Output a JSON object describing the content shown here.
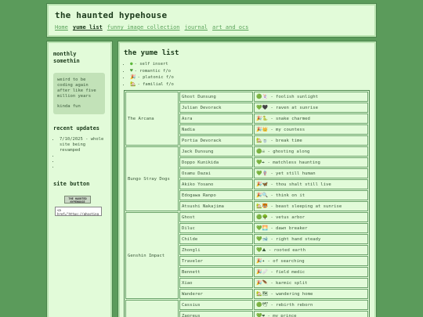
{
  "header": {
    "title": "the haunted hypehouse",
    "nav": [
      {
        "label": "Home",
        "active": false
      },
      {
        "label": "yume list",
        "active": true
      },
      {
        "label": "funny image collection",
        "active": false
      },
      {
        "label": "journal",
        "active": false
      },
      {
        "label": "art and ocs",
        "active": false
      }
    ]
  },
  "sidebar": {
    "monthly_title": "monthly somethin",
    "monthly_text": "weird to be coding again after like five million years",
    "monthly_text2": "kinda fun",
    "updates_title": "recent updates",
    "updates": [
      "7/10/2025 - whole site being revamped",
      "",
      "",
      ""
    ],
    "button_title": "site button",
    "button_label": "THE HAUNTED HYPEHOUSE",
    "button_code": "<a href=\"https://ghosting"
  },
  "main": {
    "title": "the yume list",
    "legend": [
      {
        "icon": "green-circle",
        "color": "#5cb83a",
        "text": "- self insert"
      },
      {
        "icon": "green-heart",
        "color": "#4a9b3a",
        "text": "- romantic f/o"
      },
      {
        "icon": "party-popper",
        "color": "#d9a020",
        "text": "- platonic f/o"
      },
      {
        "icon": "house",
        "color": "#c8702a",
        "text": "- familial f/o"
      }
    ],
    "groups": [
      {
        "name": "The Arcana",
        "rows": [
          {
            "name": "Ghost Dunsung",
            "icons": "🟢🃏",
            "desc": "- foolish sunlight"
          },
          {
            "name": "Julian Devorack",
            "icons": "💚🖤",
            "desc": "- raven at sunrise"
          },
          {
            "name": "Asra",
            "icons": "🎉🐍",
            "desc": "- snake charmed"
          },
          {
            "name": "Nadia",
            "icons": "🎉👑",
            "desc": "- my countess"
          },
          {
            "name": "Portia Devorack",
            "icons": "🏡🍵",
            "desc": "- break time"
          }
        ]
      },
      {
        "name": "Bungo Stray Dogs",
        "rows": [
          {
            "name": "Jack Dunsung",
            "icons": "🟢☠",
            "desc": "- ghosting along"
          },
          {
            "name": "Doppo Kunikida",
            "icons": "💚✒",
            "desc": "- matchless haunting"
          },
          {
            "name": "Osamu Dazai",
            "icons": "💚🪢",
            "desc": "- yet still human"
          },
          {
            "name": "Akiko Yosano",
            "icons": "🎉🦋",
            "desc": "- thou shalt still live"
          },
          {
            "name": "Edogawa Ranpo",
            "icons": "🎉🔍",
            "desc": "- think on it"
          },
          {
            "name": "Atsushi Nakajima",
            "icons": "🏡🐯",
            "desc": "- beast sleeping at sunrise"
          }
        ]
      },
      {
        "name": "Genshin Impact",
        "rows": [
          {
            "name": "Ghost",
            "icons": "🟢🌳",
            "desc": "- vetus arbor"
          },
          {
            "name": "Diluc",
            "icons": "💚🌅",
            "desc": "- dawn breaker"
          },
          {
            "name": "Childe",
            "icons": "💚🐋",
            "desc": "- right hand steady"
          },
          {
            "name": "Zhongli",
            "icons": "💚⛰",
            "desc": "- rooted earth"
          },
          {
            "name": "Traveler",
            "icons": "🎉✦",
            "desc": "- of searching"
          },
          {
            "name": "Bennett",
            "icons": "🎉🩹",
            "desc": "- field medic"
          },
          {
            "name": "Xiao",
            "icons": "🎉🪶",
            "desc": "- karmic split"
          },
          {
            "name": "Wanderer",
            "icons": "🏡🗺",
            "desc": "- wandering home"
          }
        ]
      },
      {
        "name": "",
        "rows": [
          {
            "name": "Cassius",
            "icons": "🟢🕊",
            "desc": "- rebirth reborn"
          },
          {
            "name": "Zagreus",
            "icons": "💚❤",
            "desc": "- my prince"
          }
        ]
      }
    ]
  }
}
